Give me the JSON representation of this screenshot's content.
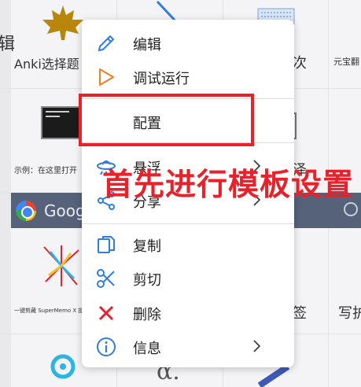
{
  "background": {
    "tile_labels": {
      "anki_label": "Anki选择题",
      "left_clip_char": "辑",
      "right_top_1": "次",
      "right_top_2": "元宝翻",
      "example_label": "示例：在这里打开",
      "right_mid": "泽",
      "google_text": "Goog",
      "supermemo_label": "一键剪藏 SuperMemo X 提炼",
      "right_bottom_1": "签",
      "right_bottom_2": "写护"
    },
    "colors": {
      "google_bar": "#55627a",
      "maple_leaf": "#b8860b"
    }
  },
  "context_menu": {
    "items": [
      {
        "label": "编辑",
        "icon": "pencil-icon"
      },
      {
        "label": "调试运行",
        "icon": "play-icon"
      },
      {
        "label": "配置",
        "icon": ""
      },
      {
        "label": "悬浮",
        "icon": "ufo-icon",
        "submenu": true
      },
      {
        "label": "分享",
        "icon": "share-icon",
        "submenu": true
      },
      {
        "label": "复制",
        "icon": "copy-icon"
      },
      {
        "label": "剪切",
        "icon": "scissors-icon"
      },
      {
        "label": "删除",
        "icon": "delete-x-icon"
      },
      {
        "label": "信息",
        "icon": "info-icon",
        "submenu": true
      }
    ],
    "colors": {
      "icon_blue": "#2f7de1",
      "play_orange": "#f47b20",
      "delete_red": "#e8212b"
    }
  },
  "annotation": {
    "text": "首先进行模板设置",
    "color": "#e8212b"
  }
}
